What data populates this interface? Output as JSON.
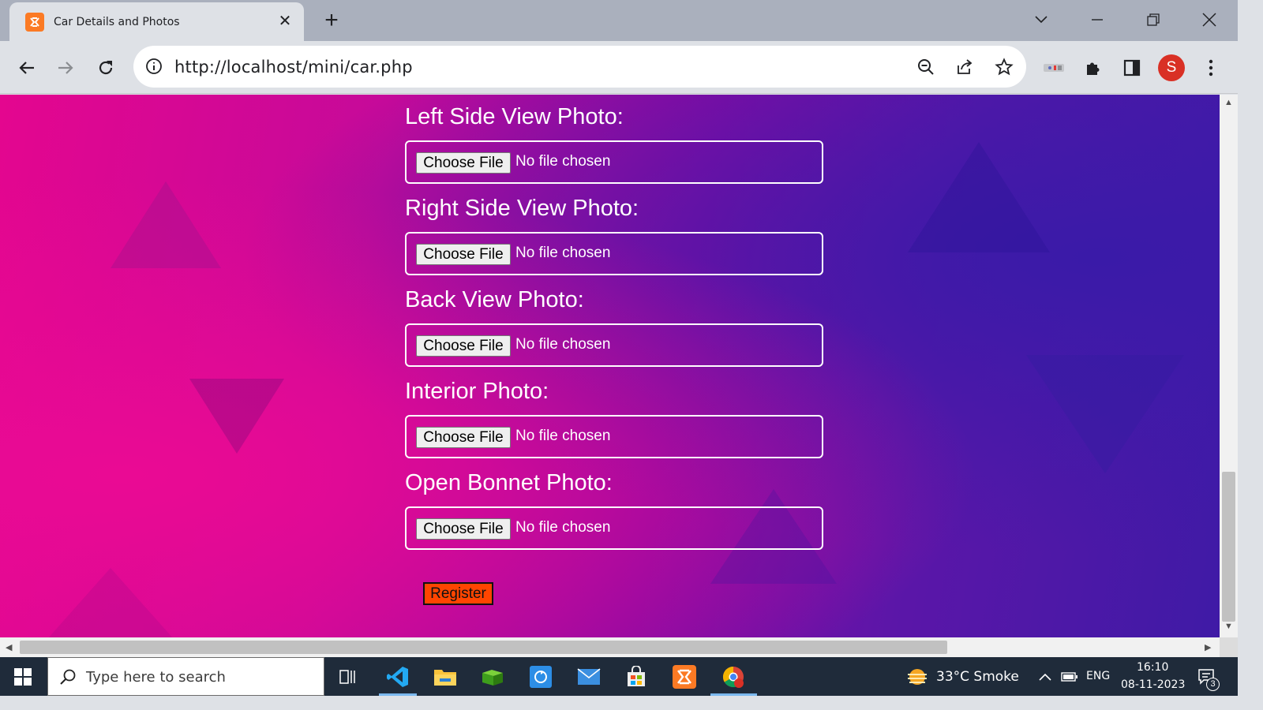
{
  "browser": {
    "tab_title": "Car Details and Photos",
    "url": "http://localhost/mini/car.php",
    "profile_initial": "S",
    "new_tab_glyph": "+",
    "close_glyph": "✕"
  },
  "form": {
    "fields": [
      {
        "label": "Left Side View Photo:",
        "button": "Choose File",
        "status": "No file chosen"
      },
      {
        "label": "Right Side View Photo:",
        "button": "Choose File",
        "status": "No file chosen"
      },
      {
        "label": "Back View Photo:",
        "button": "Choose File",
        "status": "No file chosen"
      },
      {
        "label": "Interior Photo:",
        "button": "Choose File",
        "status": "No file chosen"
      },
      {
        "label": "Open Bonnet Photo:",
        "button": "Choose File",
        "status": "No file chosen"
      }
    ],
    "submit_label": "Register"
  },
  "taskbar": {
    "search_placeholder": "Type here to search",
    "weather": "33°C  Smoke",
    "language": "ENG",
    "time": "16:10",
    "date": "08-11-2023",
    "notification_count": "3"
  },
  "colors": {
    "accent_register": "#ff4500",
    "profile": "#d93025",
    "xampp": "#fb7a24"
  },
  "icons": {
    "tab": "xampp-icon",
    "back": "arrow-left-icon",
    "forward": "arrow-right-icon",
    "reload": "reload-icon",
    "zoom": "zoom-out-icon",
    "share": "share-icon",
    "bookmark": "star-icon",
    "extensions": "puzzle-icon",
    "sidepanel": "side-panel-icon",
    "menu": "kebab-menu-icon"
  }
}
